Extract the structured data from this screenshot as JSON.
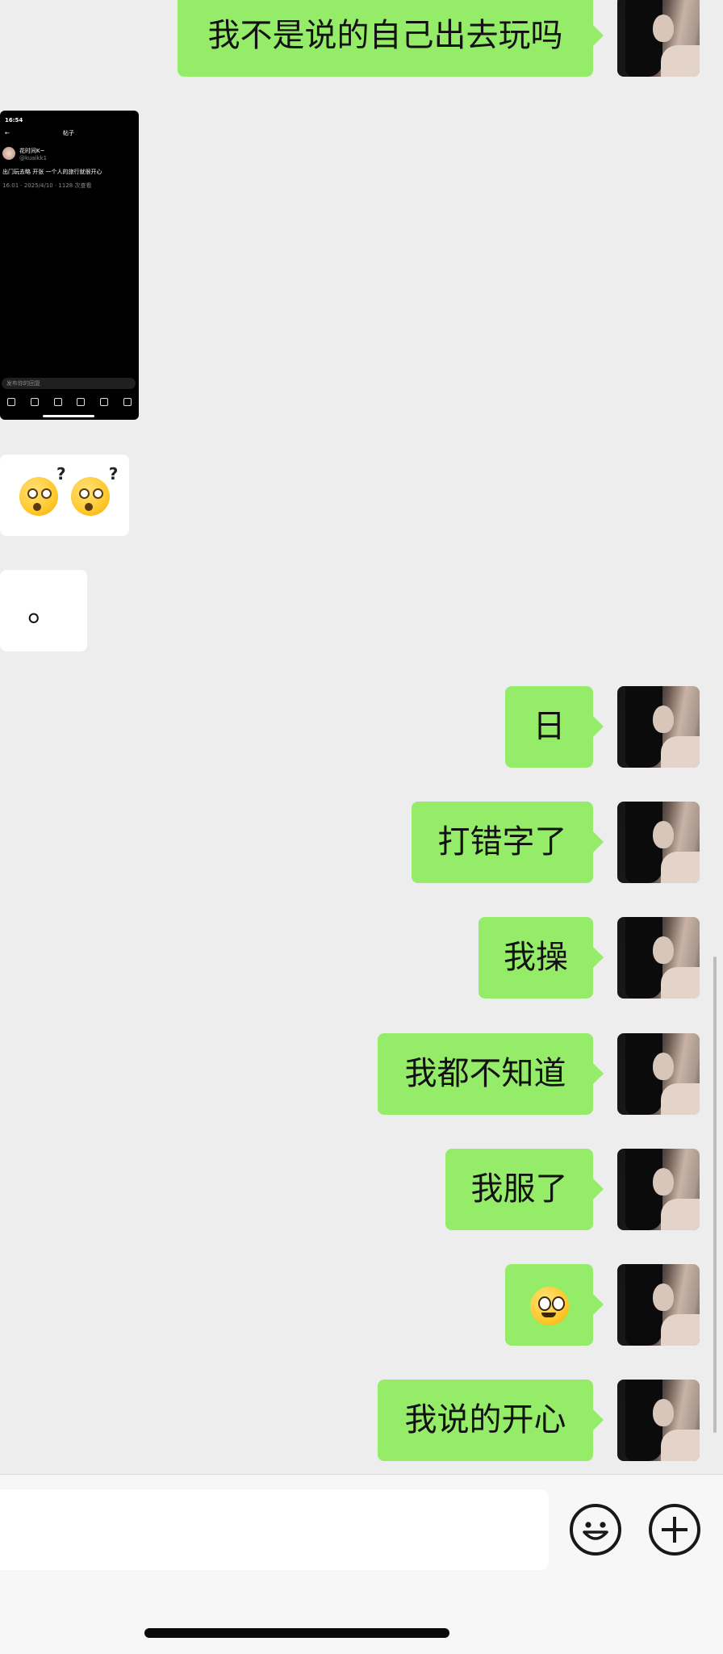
{
  "chat": {
    "msg_outgoing_1": "我不是说的自己出去玩吗",
    "msg_incoming_period": "。",
    "msg_outgoing_2": "日",
    "msg_outgoing_3": "打错字了",
    "msg_outgoing_4": "我操",
    "msg_outgoing_5": "我都不知道",
    "msg_outgoing_6": "我服了",
    "msg_outgoing_8": "我说的开心"
  },
  "shared_screenshot": {
    "status_time": "16:54",
    "page_title": "帖子",
    "author_name": "花时间K~",
    "author_handle": "@kuaikk1",
    "post_text": "出门玩去略 开张 一个人的旅行就很开心",
    "post_meta": "16:01 · 2025/4/10 · 1128 次查看",
    "reply_placeholder": "发布你的回复"
  },
  "icons": {
    "emoji_confused": "face-with-question-marks",
    "emoji_pleading": "pleading-face",
    "smiley": "smiley-face-icon",
    "plus": "plus-icon"
  },
  "colors": {
    "sent_bubble": "#95ec69",
    "received_bubble": "#ffffff",
    "background": "#ededed"
  }
}
